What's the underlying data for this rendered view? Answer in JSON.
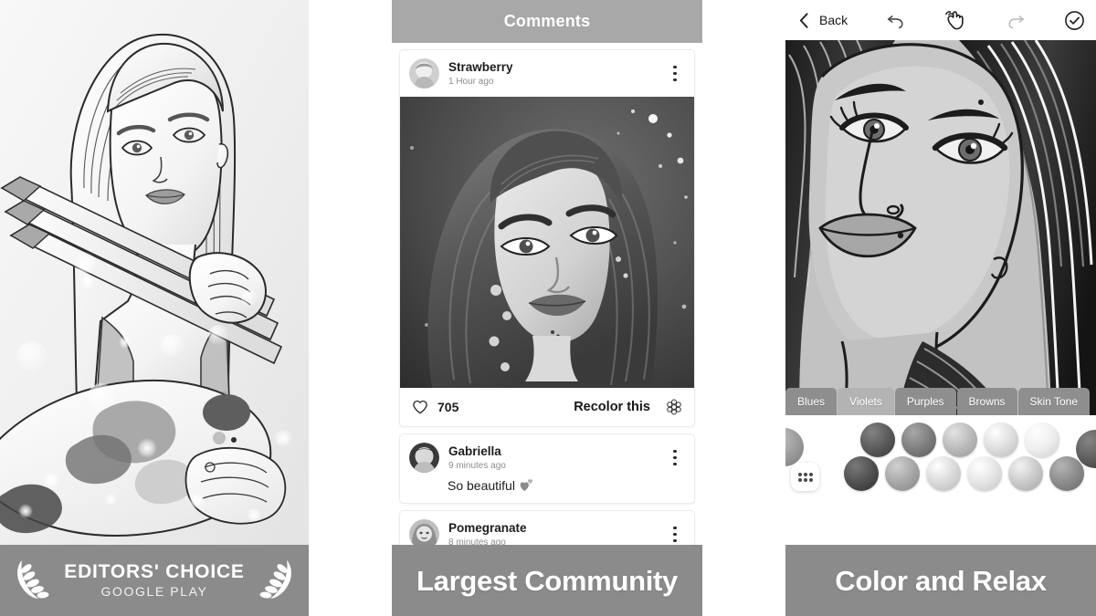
{
  "panels": {
    "editors_choice": {
      "banner": {
        "award_title": "EDITORS' CHOICE",
        "award_subtitle": "GOOGLE PLAY"
      },
      "artwork_alt": "Illustrated woman holding paintbrushes and a paint palette"
    },
    "community": {
      "header_title": "Comments",
      "banner_text": "Largest Community",
      "post": {
        "author": "Strawberry",
        "timestamp": "1 Hour ago",
        "menu_icon": "kebab-menu-icon",
        "artwork_alt": "Coloring of a woman with long wavy hair on a starry background",
        "like_icon": "heart-outline-icon",
        "like_count": "705",
        "recolor_label": "Recolor this",
        "recolor_icon": "flower-rosette-icon"
      },
      "comments": [
        {
          "author": "Gabriella",
          "timestamp": "9 minutes ago",
          "text": "So beautiful",
          "emoji": "two-hearts-icon",
          "menu_icon": "kebab-menu-icon"
        },
        {
          "author": "Pomegranate",
          "timestamp": "8 minutes ago",
          "text": "",
          "emoji": "",
          "menu_icon": "kebab-menu-icon"
        }
      ]
    },
    "color_editor": {
      "banner_text": "Color and Relax",
      "toolbar": {
        "back_label": "Back",
        "back_icon": "chevron-left-icon",
        "undo_icon": "undo-arrow-icon",
        "hand_icon": "hand-pointer-icon",
        "redo_icon": "redo-arrow-icon",
        "done_icon": "check-circle-icon"
      },
      "artwork_alt": "Line-art portrait of a woman with flowing hair being colored",
      "palette_tabs": [
        {
          "label": "Blues",
          "active": false
        },
        {
          "label": "Violets",
          "active": true
        },
        {
          "label": "Purples",
          "active": false
        },
        {
          "label": "Browns",
          "active": false
        },
        {
          "label": "Skin Tone",
          "active": false
        }
      ],
      "more_colors_icon": "dot-grid-palette-icon",
      "swatch_rows": [
        {
          "colors": [
            "#595959",
            "#7d7d7d",
            "#b9b9b9",
            "#dcdcdc",
            "#ededed"
          ]
        },
        {
          "colors": [
            "#4f4f4f",
            "#a6a6a6",
            "#d8d8d8",
            "#e4e4e4",
            "#c8c8c8",
            "#8a8a8a"
          ]
        }
      ],
      "edge_swatch_left": "#9a9a9a",
      "edge_swatch_right": "#5a5a5a"
    }
  },
  "theme": {
    "banner_bg": "#8b8b8b",
    "header_bg": "#a8a8a8",
    "tab_bg": "#8e8e8e",
    "tab_active_bg": "#b3b3b3",
    "text_dark": "#1c1c1c",
    "text_muted": "#8e8e8e",
    "page_bg": "#ffffff"
  }
}
